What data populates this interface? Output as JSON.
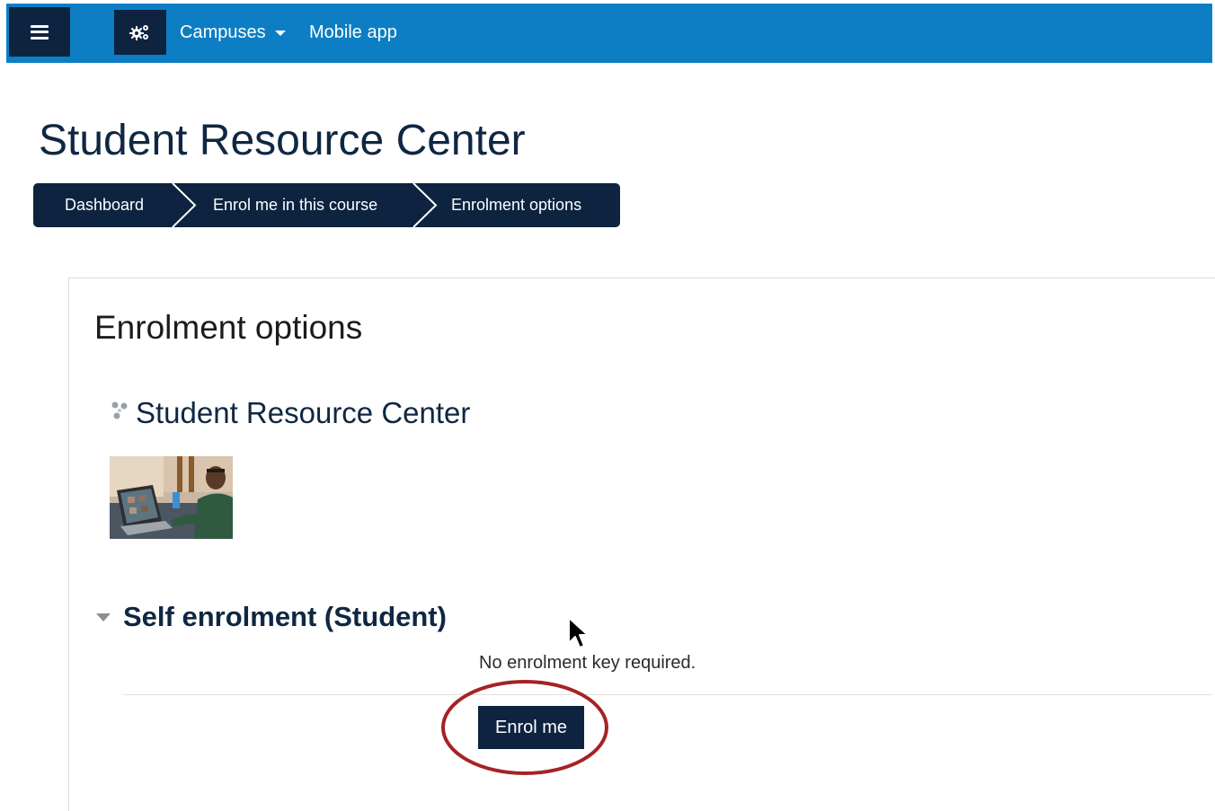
{
  "navbar": {
    "menu_icon": "hamburger-menu-icon",
    "settings_icon": "gears-icon",
    "campuses_label": "Campuses",
    "mobile_app_label": "Mobile app",
    "color": "#0d7ec4"
  },
  "page": {
    "title": "Student Resource Center"
  },
  "breadcrumb": {
    "items": [
      {
        "label": "Dashboard"
      },
      {
        "label": "Enrol me in this course"
      },
      {
        "label": "Enrolment options"
      }
    ],
    "color": "#0d2340"
  },
  "main": {
    "heading": "Enrolment options",
    "course": {
      "icon": "course-dots-icon",
      "title": "Student Resource Center",
      "thumbnail": "person-at-laptop-video-call-image"
    },
    "enrol_method": {
      "title": "Self enrolment (Student)",
      "note": "No enrolment key required.",
      "button_label": "Enrol me",
      "highlight_color": "#a52226"
    }
  }
}
